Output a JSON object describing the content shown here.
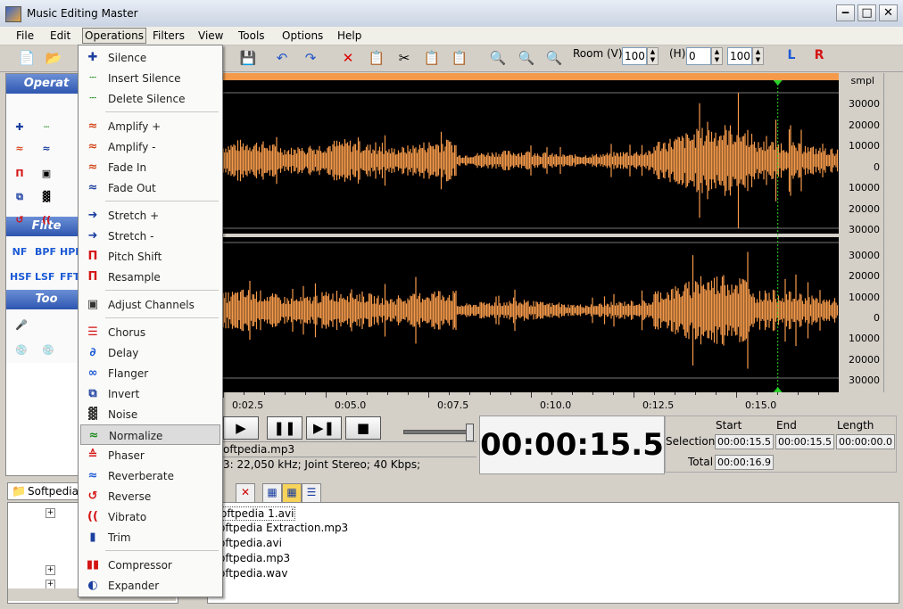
{
  "window": {
    "title": "Music Editing Master",
    "minimize": "‒",
    "maximize": "□",
    "close": "✕"
  },
  "menu": [
    "File",
    "Edit",
    "Operations",
    "Filters",
    "View",
    "Tools",
    "Options",
    "Help"
  ],
  "toolbar": {
    "room_v_label": "Room (V)",
    "room_v_value": "100",
    "h_label": "(H)",
    "h_value": "0",
    "h_value2": "100",
    "left_channel": "L",
    "right_channel": "R"
  },
  "left_panel": {
    "operations_header": "Operat",
    "filters_header": "Filte",
    "tools_header": "Too",
    "filter_icons": [
      "NF",
      "BPF",
      "HPF",
      "HSF",
      "LSF",
      "FFT"
    ]
  },
  "operations_menu": [
    {
      "label": "Silence"
    },
    {
      "label": "Insert Silence"
    },
    {
      "label": "Delete Silence"
    },
    {
      "label": "Amplify +"
    },
    {
      "label": "Amplify -"
    },
    {
      "label": "Fade In"
    },
    {
      "label": "Fade Out"
    },
    {
      "label": "Stretch +"
    },
    {
      "label": "Stretch -"
    },
    {
      "label": "Pitch Shift"
    },
    {
      "label": "Resample"
    },
    {
      "label": "Adjust Channels"
    },
    {
      "label": "Chorus"
    },
    {
      "label": "Delay"
    },
    {
      "label": "Flanger"
    },
    {
      "label": "Invert"
    },
    {
      "label": "Noise"
    },
    {
      "label": "Normalize"
    },
    {
      "label": "Phaser"
    },
    {
      "label": "Reverberate"
    },
    {
      "label": "Reverse"
    },
    {
      "label": "Vibrato"
    },
    {
      "label": "Trim"
    },
    {
      "label": "Compressor"
    },
    {
      "label": "Expander"
    }
  ],
  "waveform": {
    "unit": "smpl",
    "scale_top": [
      "30000",
      "20000",
      "10000",
      "0",
      "10000",
      "20000",
      "30000"
    ],
    "scale_bottom": [
      "30000",
      "20000",
      "10000",
      "0",
      "10000",
      "20000",
      "30000"
    ],
    "wave_color": "#f59a4b",
    "cursor_position_fraction": 0.901
  },
  "timeline": [
    "0:02.5",
    "0:05.0",
    "0:07.5",
    "0:10.0",
    "0:12.5",
    "0:15.0"
  ],
  "file_info": {
    "name": "oftpedia.mp3",
    "details": "3: 22,050 kHz; Joint Stereo; 40 Kbps;"
  },
  "clock": "00:00:15.5",
  "selection": {
    "start_header": "Start",
    "end_header": "End",
    "length_header": "Length",
    "selection_label": "Selection",
    "total_label": "Total",
    "start": "00:00:15.5",
    "end": "00:00:15.5",
    "length": "00:00:00.0",
    "total": "00:00:16.9"
  },
  "browser": {
    "folder": "Softpedia",
    "files": [
      "oftpedia 1.avi",
      "oftpedia Extraction.mp3",
      "oftpedia.avi",
      "oftpedia.mp3",
      "oftpedia.wav"
    ]
  }
}
